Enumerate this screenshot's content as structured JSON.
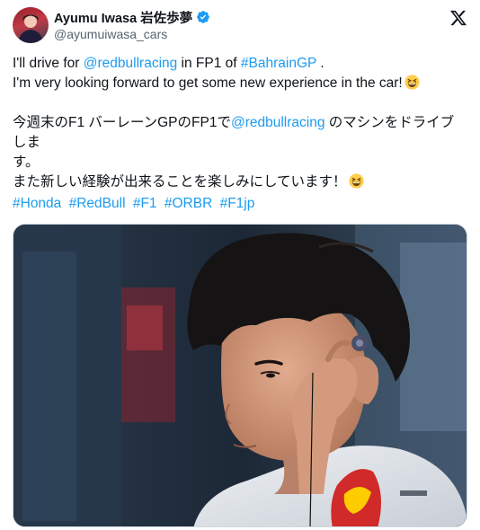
{
  "author": {
    "display_name": "Ayumu Iwasa 岩佐歩夢",
    "handle": "@ayumuiwasa_cars"
  },
  "icons": {
    "verified": "verified-badge-icon",
    "platform": "x-logo-icon",
    "emoji": "grinning-squinting-face-emoji"
  },
  "tweet": {
    "line1_pre": "I'll drive for ",
    "line1_mention": "@redbullracing",
    "line1_mid": " in FP1 of ",
    "line1_tag": "#BahrainGP",
    "line1_post": " .",
    "line2": "I'm very looking forward to get some new experience in the car!",
    "jp1_pre": "今週末のF1 バーレーンGPのFP1で",
    "jp1_mention": "@redbullracing",
    "jp1_post": " のマシンをドライブしま",
    "jp2": "す。",
    "jp3": "また新しい経験が出来ることを楽しみにしています！"
  },
  "hashtags": [
    "#Honda",
    "#RedBull",
    "#F1",
    "#ORBR",
    "#F1jp"
  ],
  "colors": {
    "link": "#1d9bf0",
    "verified": "#1d9bf0",
    "text": "#0f1419",
    "secondary": "#536471"
  }
}
